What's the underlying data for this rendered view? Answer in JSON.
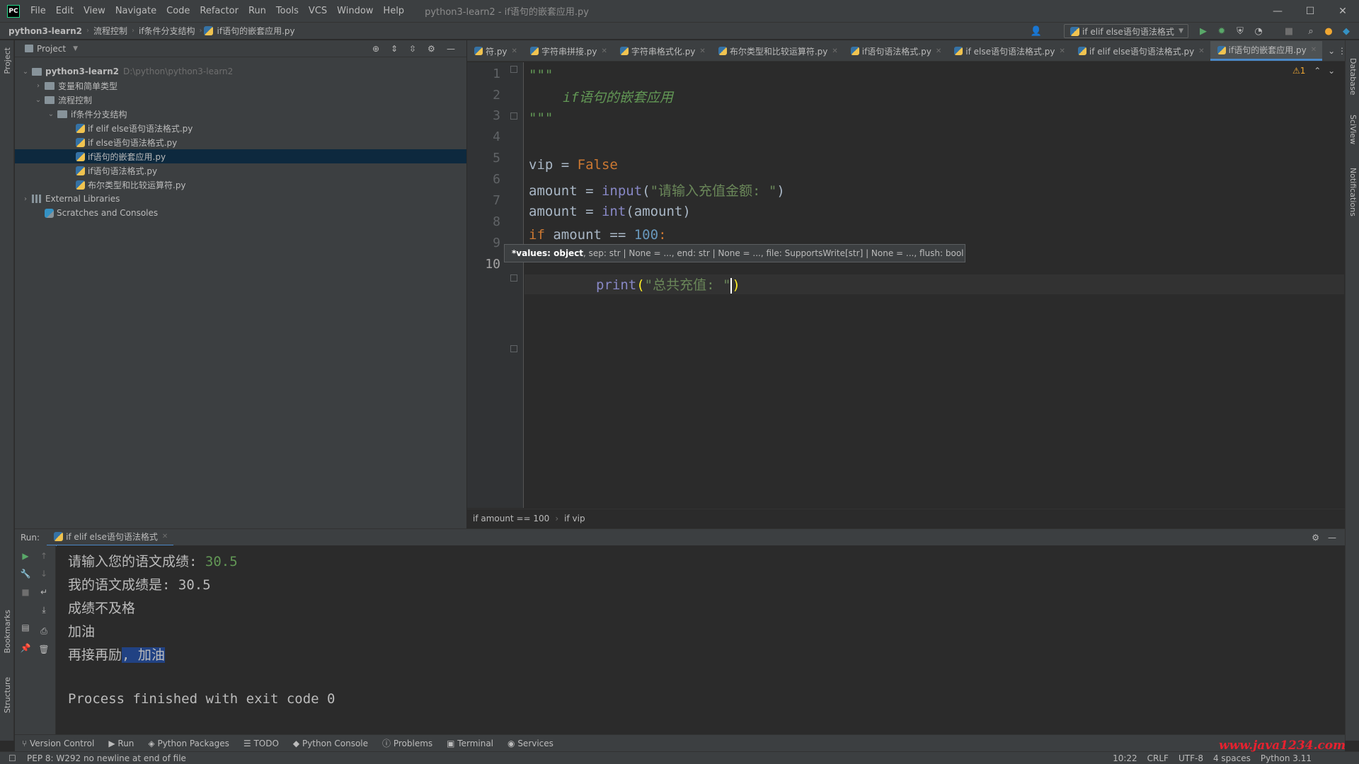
{
  "app": {
    "logo": "PC",
    "menu": [
      "File",
      "Edit",
      "View",
      "Navigate",
      "Code",
      "Refactor",
      "Run",
      "Tools",
      "VCS",
      "Window",
      "Help"
    ],
    "window_title": "python3-learn2 - if语句的嵌套应用.py",
    "win_controls": [
      "—",
      "☐",
      "✕"
    ]
  },
  "navbar": {
    "crumbs": [
      "python3-learn2",
      "流程控制",
      "if条件分支结构",
      "if语句的嵌套应用.py"
    ],
    "run_config": "if elif else语句语法格式"
  },
  "left_strip": {
    "project": "Project",
    "bookmarks": "Bookmarks",
    "structure": "Structure"
  },
  "right_strip": {
    "database": "Database",
    "sciview": "SciView",
    "notifications": "Notifications"
  },
  "project_panel": {
    "title": "Project",
    "tree": [
      {
        "label": "python3-learn2",
        "hint": "D:\\python\\python3-learn2",
        "type": "folder",
        "arrow": "⌄",
        "bold": true
      },
      {
        "label": "变量和简单类型",
        "type": "folder",
        "arrow": "›"
      },
      {
        "label": "流程控制",
        "type": "folder",
        "arrow": "⌄"
      },
      {
        "label": "if条件分支结构",
        "type": "folder",
        "arrow": "⌄"
      },
      {
        "label": "if elif else语句语法格式.py",
        "type": "py"
      },
      {
        "label": "if else语句语法格式.py",
        "type": "py"
      },
      {
        "label": "if语句的嵌套应用.py",
        "type": "py",
        "selected": true
      },
      {
        "label": "if语句语法格式.py",
        "type": "py"
      },
      {
        "label": "布尔类型和比较运算符.py",
        "type": "py"
      },
      {
        "label": "External Libraries",
        "type": "lib",
        "arrow": "›"
      },
      {
        "label": "Scratches and Consoles",
        "type": "scratch"
      }
    ]
  },
  "tabs": [
    {
      "label": "符.py",
      "active": false
    },
    {
      "label": "字符串拼接.py",
      "active": false
    },
    {
      "label": "字符串格式化.py",
      "active": false
    },
    {
      "label": "布尔类型和比较运算符.py",
      "active": false
    },
    {
      "label": "if语句语法格式.py",
      "active": false
    },
    {
      "label": "if else语句语法格式.py",
      "active": false
    },
    {
      "label": "if elif else语句语法格式.py",
      "active": false
    },
    {
      "label": "if语句的嵌套应用.py",
      "active": true
    }
  ],
  "editor": {
    "line_numbers": [
      "1",
      "2",
      "3",
      "4",
      "5",
      "6",
      "7",
      "8",
      "9",
      "10"
    ],
    "warning_badge": "⚠1",
    "param_hint_bold": "*values: object",
    "param_hint_rest": ", sep: str | None = ..., end: str | None = ..., file: SupportsWrite[str] | None = ..., flush: bool = ...",
    "code": {
      "l1": "\"\"\"",
      "l2": "if语句的嵌套应用",
      "l3": "\"\"\"",
      "l5_var": "vip = ",
      "l5_val": "False",
      "l6_var": "amount = ",
      "l6_fn": "input",
      "l6_str": "\"请输入充值金额: \"",
      "l7_var": "amount = ",
      "l7_fn": "int",
      "l7_arg": "(amount)",
      "l8_kw": "if",
      "l8_mid": " amount == ",
      "l8_num": "100",
      "l8_end": ":",
      "l10_fn": "print",
      "l10_str": "\"总共充值: \""
    },
    "breadcrumb": [
      "if amount == 100",
      "if vip"
    ]
  },
  "run": {
    "label": "Run:",
    "tab": "if elif else语句语法格式",
    "console": {
      "prompt": "请输入您的语文成绩: ",
      "input": "30.5",
      "line2": "我的语文成绩是: 30.5",
      "line3": "成绩不及格",
      "line4": "加油",
      "line5a": "再接再励",
      "line5b": ", 加油",
      "exit": "Process finished with exit code 0"
    }
  },
  "toolwindows": [
    "Version Control",
    "Run",
    "Python Packages",
    "TODO",
    "Python Console",
    "Problems",
    "Terminal",
    "Services"
  ],
  "status": {
    "message": "PEP 8: W292 no newline at end of file",
    "right": [
      "10:22",
      "CRLF",
      "UTF-8",
      "4 spaces",
      "Python 3.11"
    ]
  },
  "watermark": "www.java1234.com"
}
